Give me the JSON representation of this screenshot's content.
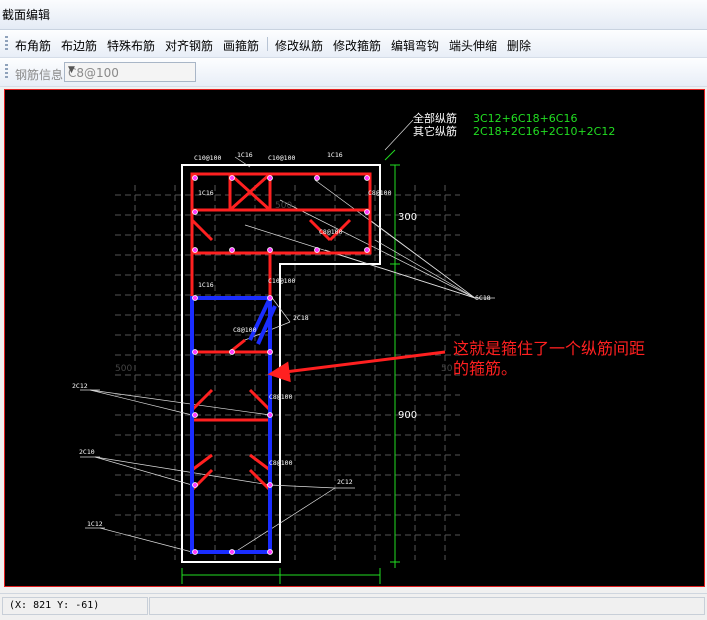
{
  "window": {
    "title": "截面编辑"
  },
  "toolbar": {
    "buttons": [
      "布角筋",
      "布边筋",
      "特殊布筋",
      "对齐钢筋",
      "画箍筋",
      "修改纵筋",
      "修改箍筋",
      "编辑弯钩",
      "端头伸缩",
      "删除"
    ]
  },
  "rebar_info": {
    "label": "钢筋信息",
    "value": "C8@100"
  },
  "drawing": {
    "summary": {
      "all_label": "全部纵筋",
      "all_value": "3C12+6C18+6C16",
      "other_label": "其它纵筋",
      "other_value": "2C18+2C16+2C10+2C12"
    },
    "annotation": [
      "这就是箍住了一个纵筋间距",
      "的箍筋。"
    ],
    "dims": {
      "d300": "300",
      "d900": "900",
      "m500a": "500",
      "m500b": "500",
      "m50": "50"
    },
    "labels": {
      "c10_top": "C10@100",
      "c16_top": "1C16",
      "c10_top2": "C10@100",
      "c16_top2": "1C16",
      "c16_left": "1C16",
      "c8_right": "C8@100",
      "c8_mid": "C8@100",
      "c16_mid": "1C16",
      "c10_mid": "C10@100",
      "c8_inner": "C8@100",
      "c18": "2C18",
      "c6_right": "6C18",
      "c12_left": "2C12",
      "c8_low1": "C8@100",
      "c10_left": "2C10",
      "c8_low2": "C8@100",
      "c12_right": "2C12",
      "c12_bottom": "1C12"
    }
  },
  "status": {
    "coords": "(X: 821 Y: -61)"
  },
  "colors": {
    "red": "#ff2020",
    "blue": "#1a2dff",
    "green": "#22dd22",
    "white": "#ffffff",
    "grid": "#555555"
  }
}
